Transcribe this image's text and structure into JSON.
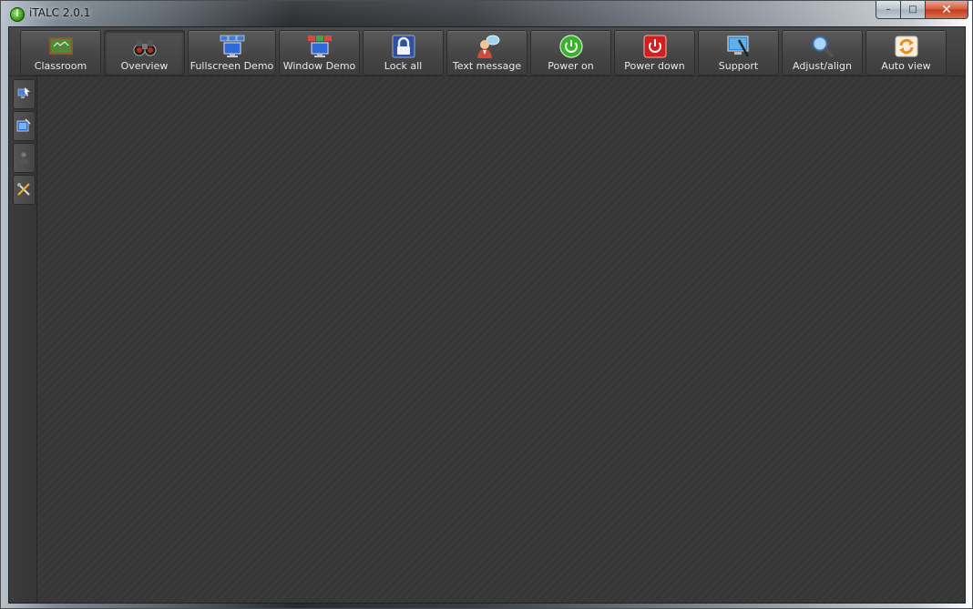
{
  "window": {
    "title": "iTALC 2.0.1",
    "app_icon_glyph": "i",
    "controls": {
      "minimize": "–",
      "maximize": "□",
      "close": "✕"
    }
  },
  "toolbar": {
    "buttons": [
      {
        "label": "Classroom",
        "icon": "chalkboard-icon",
        "active": false
      },
      {
        "label": "Overview",
        "icon": "binoculars-icon",
        "active": true
      },
      {
        "label": "Fullscreen Demo",
        "icon": "fullscreen-demo-icon",
        "active": false
      },
      {
        "label": "Window Demo",
        "icon": "window-demo-icon",
        "active": false
      },
      {
        "label": "Lock all",
        "icon": "lock-icon",
        "active": false
      },
      {
        "label": "Text message",
        "icon": "text-message-icon",
        "active": false
      },
      {
        "label": "Power on",
        "icon": "power-on-icon",
        "active": false
      },
      {
        "label": "Power down",
        "icon": "power-down-icon",
        "active": false
      },
      {
        "label": "Support",
        "icon": "support-icon",
        "active": false
      },
      {
        "label": "Adjust/align",
        "icon": "magnifier-icon",
        "active": false
      },
      {
        "label": "Auto view",
        "icon": "auto-view-icon",
        "active": false
      }
    ]
  },
  "sidebar": {
    "items": [
      {
        "icon": "computers-icon"
      },
      {
        "icon": "snapshots-icon"
      },
      {
        "icon": "users-icon"
      },
      {
        "icon": "tools-icon"
      }
    ]
  },
  "colors": {
    "background": "#3a3a3a",
    "toolbar_text": "#e8e8e8",
    "close_button": "#c13a1f",
    "power_on": "#36b32a",
    "power_down": "#d11f1f"
  }
}
